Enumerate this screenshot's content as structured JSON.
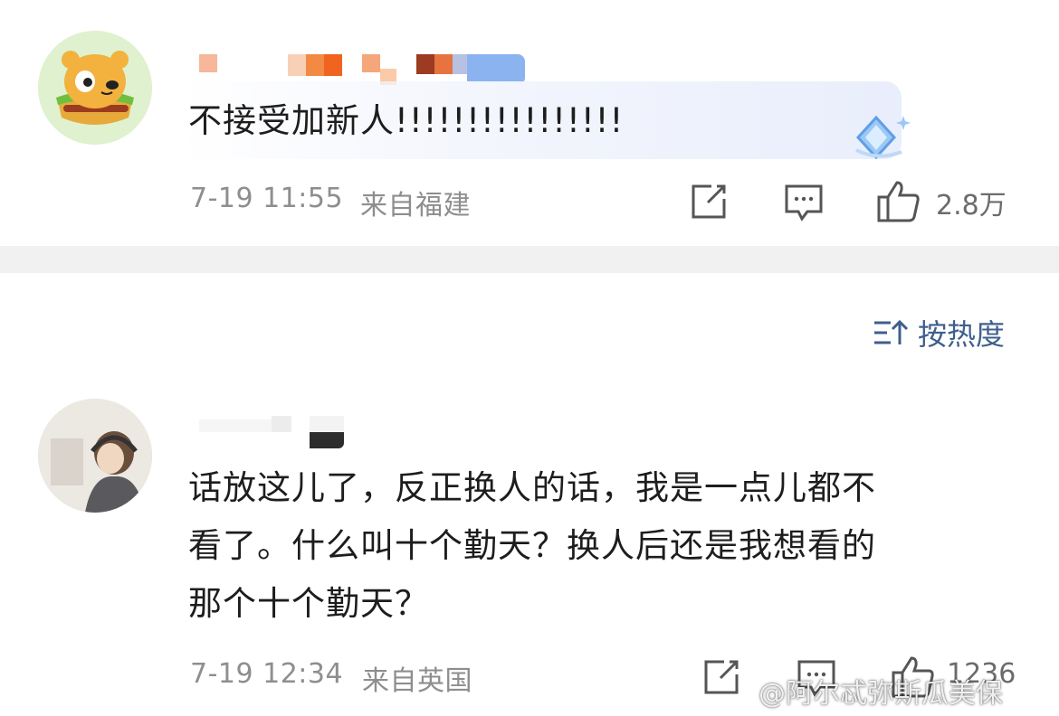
{
  "comments": [
    {
      "text": "不接受加新人!!!!!!!!!!!!!!!!",
      "time": "7-19 11:55",
      "location": "来自福建",
      "likes": "2.8万",
      "avatar_icon": "burger-bear-avatar",
      "badge_icon": "diamond-badge-icon"
    },
    {
      "text_lines": [
        "话放这儿了，反正换人的话，我是一点儿都不",
        "看了。什么叫十个勤天？换人后还是我想看的",
        "那个十个勤天？"
      ],
      "time": "7-19 12:34",
      "location": "来自英国",
      "likes": "1236",
      "avatar_icon": "girl-headphones-avatar"
    }
  ],
  "sort": {
    "label": "按热度",
    "icon": "sort-icon"
  },
  "watermark": "@阿尔忒弥斯瓜美保",
  "colors": {
    "accent": "#3f5f8d",
    "meta": "#8e8e8e",
    "text": "#1d1d1d"
  }
}
